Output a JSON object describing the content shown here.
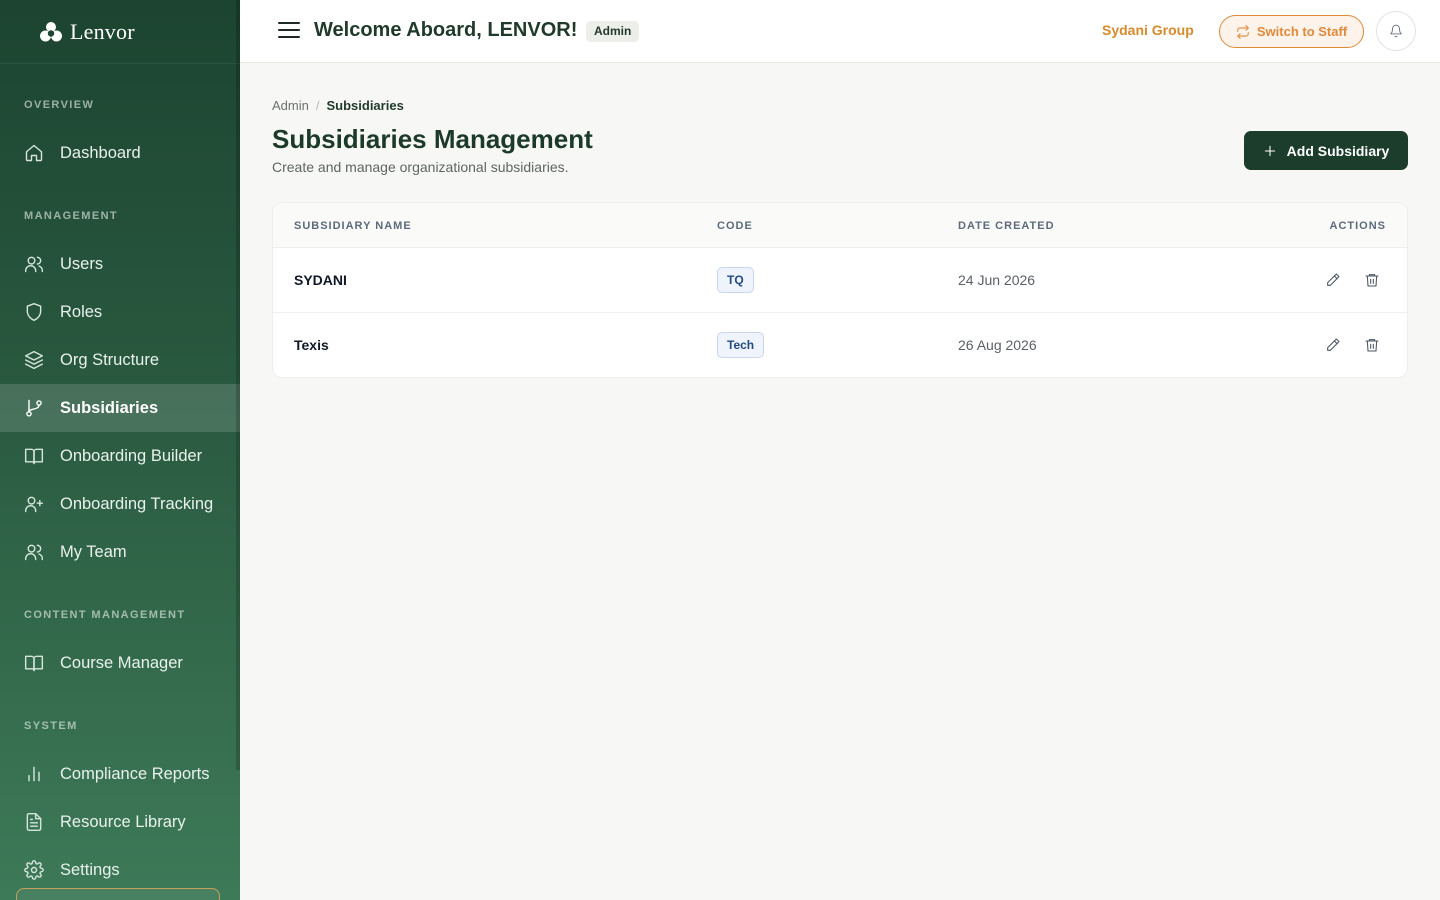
{
  "sidebar": {
    "brand": "Lenvor",
    "sections": [
      {
        "label": "OVERVIEW",
        "items": [
          {
            "label": "Dashboard",
            "icon": "home-icon"
          }
        ]
      },
      {
        "label": "MANAGEMENT",
        "items": [
          {
            "label": "Users",
            "icon": "users-icon"
          },
          {
            "label": "Roles",
            "icon": "shield-icon"
          },
          {
            "label": "Org Structure",
            "icon": "layers-icon"
          },
          {
            "label": "Subsidiaries",
            "icon": "git-branch-icon",
            "active": true
          },
          {
            "label": "Onboarding Builder",
            "icon": "book-icon"
          },
          {
            "label": "Onboarding Tracking",
            "icon": "user-plus-icon"
          },
          {
            "label": "My Team",
            "icon": "users-icon"
          }
        ]
      },
      {
        "label": "CONTENT MANAGEMENT",
        "items": [
          {
            "label": "Course Manager",
            "icon": "book-icon"
          }
        ]
      },
      {
        "label": "SYSTEM",
        "items": [
          {
            "label": "Compliance Reports",
            "icon": "bar-chart-icon"
          },
          {
            "label": "Resource Library",
            "icon": "file-text-icon"
          },
          {
            "label": "Settings",
            "icon": "gear-icon"
          }
        ]
      }
    ]
  },
  "header": {
    "welcome": "Welcome Aboard, LENVOR!",
    "role_badge": "Admin",
    "org_name": "Sydani Group",
    "switch_label": "Switch to Staff"
  },
  "breadcrumb": {
    "root": "Admin",
    "current": "Subsidiaries"
  },
  "page": {
    "title": "Subsidiaries Management",
    "subtitle": "Create and manage organizational subsidiaries.",
    "add_label": "Add Subsidiary"
  },
  "table": {
    "columns": [
      "SUBSIDIARY NAME",
      "CODE",
      "DATE CREATED",
      "ACTIONS"
    ],
    "rows": [
      {
        "name": "SYDANI",
        "code": "TQ",
        "date": "24 Jun 2026"
      },
      {
        "name": "Texis",
        "code": "Tech",
        "date": "26 Aug 2026"
      }
    ]
  },
  "colors": {
    "sidebar_dark": "#1c4430",
    "accent_orange": "#e08a3a",
    "primary_button": "#1c3d2c"
  }
}
